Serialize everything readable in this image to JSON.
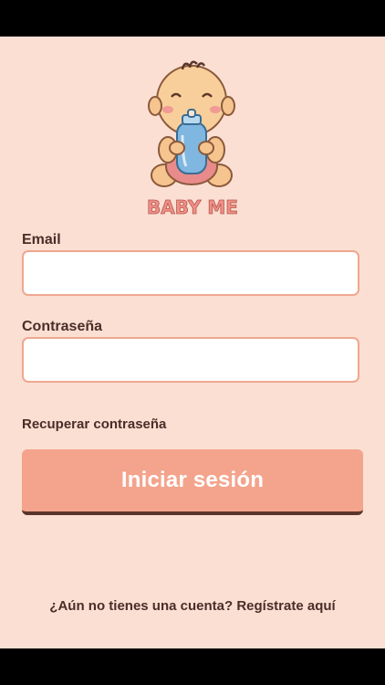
{
  "app": {
    "brand_text": "BABY ME",
    "logo_icon": "baby-with-bottle-icon"
  },
  "login_form": {
    "email_label": "Email",
    "email_value": "",
    "password_label": "Contraseña",
    "password_value": "",
    "recover_link": "Recuperar contraseña",
    "submit_label": "Iniciar sesión"
  },
  "footer": {
    "register_prompt": "¿Aún no tienes una cuenta?",
    "register_link": "Regístrate aquí"
  },
  "colors": {
    "background": "#fbdfd3",
    "input_border": "#efa78f",
    "button": "#f4a48c",
    "button_shadow": "#5b3529",
    "text": "#4a2e27"
  }
}
